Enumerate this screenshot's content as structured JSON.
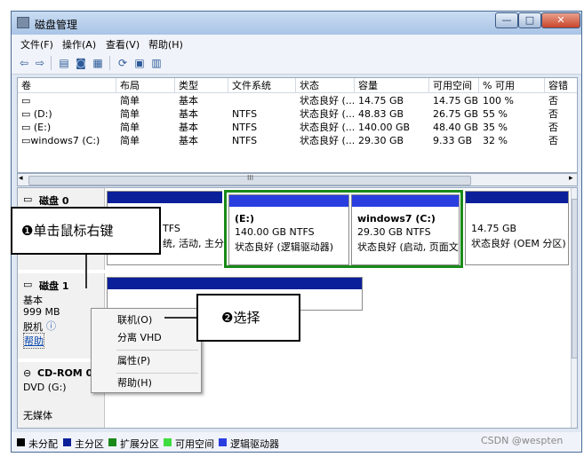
{
  "window": {
    "title": "磁盘管理",
    "minimize": "—",
    "maximize": "□",
    "close": "✕"
  },
  "menu": [
    "文件(F)",
    "操作(A)",
    "查看(V)",
    "帮助(H)"
  ],
  "toolbar_icons": [
    "back-arrow-icon",
    "forward-arrow-icon",
    "console-tree-icon",
    "help-book-icon",
    "view-icon",
    "refresh-icon",
    "properties-icon",
    "disk-manage-icon"
  ],
  "volume_table": {
    "columns": [
      "卷",
      "布局",
      "类型",
      "文件系统",
      "状态",
      "容量",
      "可用空间",
      "% 可用",
      "容错"
    ],
    "rows": [
      [
        "",
        "简单",
        "基本",
        "",
        "状态良好 (...",
        "14.75 GB",
        "14.75 GB",
        "100 %",
        "否"
      ],
      [
        "(D:)",
        "简单",
        "基本",
        "NTFS",
        "状态良好 (...",
        "48.83 GB",
        "26.75 GB",
        "55 %",
        "否"
      ],
      [
        "(E:)",
        "简单",
        "基本",
        "NTFS",
        "状态良好 (...",
        "140.00 GB",
        "48.40 GB",
        "35 %",
        "否"
      ],
      [
        "windows7 (C:)",
        "简单",
        "基本",
        "NTFS",
        "状态良好 (...",
        "29.30 GB",
        "9.33 GB",
        "32 %",
        "否"
      ]
    ]
  },
  "hscroll_grip": "III",
  "disks": {
    "disk0": {
      "name": "磁盘 0",
      "part1_line1": "TFS",
      "part1_line2": "统, 活动, 主分",
      "part_e": {
        "title": "(E:)",
        "size": "140.00 GB NTFS",
        "status": "状态良好 (逻辑驱动器)"
      },
      "part_c": {
        "title": "windows7  (C:)",
        "size": "29.30 GB NTFS",
        "status": "状态良好 (启动, 页面文"
      },
      "part_oem": {
        "size": "14.75 GB",
        "status": "状态良好 (OEM 分区)"
      }
    },
    "disk1": {
      "name": "磁盘 1",
      "type": "基本",
      "size": "999 MB",
      "state": "脱机",
      "help": "帮助"
    },
    "cdrom": {
      "name": "CD-ROM 0",
      "type": "DVD (G:)",
      "media": "无媒体"
    }
  },
  "context_menu": [
    "联机(O)",
    "分离 VHD",
    "属性(P)",
    "帮助(H)"
  ],
  "callouts": {
    "right_click": "❶单击鼠标右键",
    "select": "❷选择"
  },
  "legend": [
    {
      "label": "未分配",
      "color": "#000000"
    },
    {
      "label": "主分区",
      "color": "#0c1f9a"
    },
    {
      "label": "扩展分区",
      "color": "#1a8a1a"
    },
    {
      "label": "可用空间",
      "color": "#3fdc3f"
    },
    {
      "label": "逻辑驱动器",
      "color": "#2a3ee0"
    }
  ],
  "watermark": "CSDN @wespten"
}
